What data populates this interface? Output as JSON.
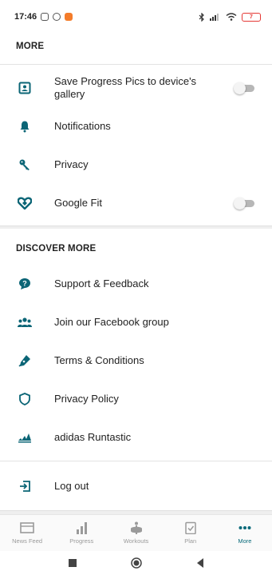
{
  "status_bar": {
    "time": "17:46",
    "battery": "7"
  },
  "more": {
    "heading": "MORE",
    "items": [
      {
        "label": "Save Progress Pics to device's gallery",
        "icon": "gallery-icon",
        "toggle": false
      },
      {
        "label": "Notifications",
        "icon": "bell-icon"
      },
      {
        "label": "Privacy",
        "icon": "key-icon"
      },
      {
        "label": "Google Fit",
        "icon": "google-fit-icon",
        "toggle": false
      }
    ]
  },
  "discover": {
    "heading": "DISCOVER MORE",
    "items": [
      {
        "label": "Support & Feedback",
        "icon": "help-chat-icon"
      },
      {
        "label": "Join our Facebook group",
        "icon": "group-icon"
      },
      {
        "label": "Terms & Conditions",
        "icon": "pen-icon"
      },
      {
        "label": "Privacy Policy",
        "icon": "shield-icon"
      },
      {
        "label": "adidas Runtastic",
        "icon": "adidas-logo-icon"
      }
    ]
  },
  "logout": {
    "label": "Log out",
    "icon": "logout-icon"
  },
  "tabs": [
    {
      "label": "News Feed",
      "icon": "newsfeed-icon",
      "active": false
    },
    {
      "label": "Progress",
      "icon": "bar-chart-icon",
      "active": false
    },
    {
      "label": "Workouts",
      "icon": "workout-icon",
      "active": false
    },
    {
      "label": "Plan",
      "icon": "checklist-icon",
      "active": false
    },
    {
      "label": "More",
      "icon": "more-dots-icon",
      "active": true
    }
  ],
  "colors": {
    "accent": "#0a6a7a",
    "icon": "#0b6576",
    "toggle_track": "#b7b7b7",
    "inactive_tab": "#9a9a9a"
  }
}
